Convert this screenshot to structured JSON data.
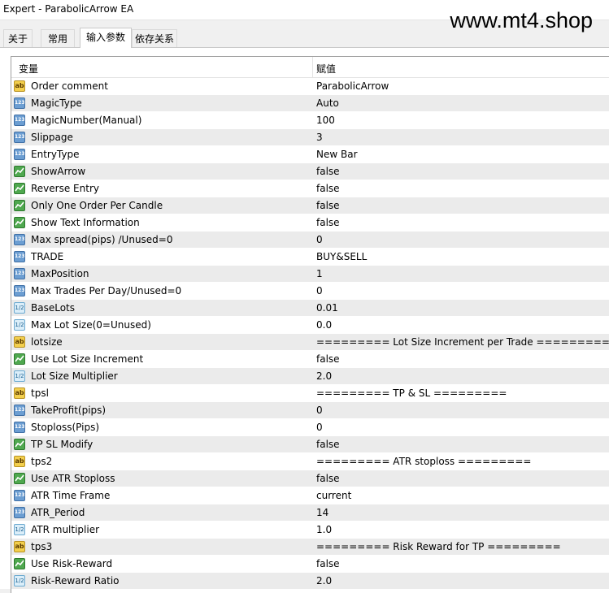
{
  "window": {
    "title": "Expert - ParabolicArrow EA"
  },
  "watermark": "www.mt4.shop",
  "tabs": [
    {
      "label": "关于"
    },
    {
      "label": "常用"
    },
    {
      "label": "输入参数"
    },
    {
      "label": "依存关系"
    }
  ],
  "grid": {
    "col_variable": "变量",
    "col_value": "赋值",
    "icon_labels": {
      "str": "ab",
      "num": "123",
      "dbl": "1/2"
    },
    "rows": [
      {
        "type": "str",
        "name": "Order comment",
        "value": "ParabolicArrow"
      },
      {
        "type": "num",
        "name": "MagicType",
        "value": "Auto"
      },
      {
        "type": "num",
        "name": "MagicNumber(Manual)",
        "value": "100"
      },
      {
        "type": "num",
        "name": "Slippage",
        "value": "3"
      },
      {
        "type": "num",
        "name": "EntryType",
        "value": "New Bar"
      },
      {
        "type": "bool",
        "name": "ShowArrow",
        "value": "false"
      },
      {
        "type": "bool",
        "name": "Reverse Entry",
        "value": "false"
      },
      {
        "type": "bool",
        "name": "Only One Order Per Candle",
        "value": "false"
      },
      {
        "type": "bool",
        "name": "Show Text Information",
        "value": "false"
      },
      {
        "type": "num",
        "name": "Max spread(pips) /Unused=0",
        "value": "0"
      },
      {
        "type": "num",
        "name": "TRADE",
        "value": "BUY&SELL"
      },
      {
        "type": "num",
        "name": "MaxPosition",
        "value": "1"
      },
      {
        "type": "num",
        "name": "Max Trades Per Day/Unused=0",
        "value": "0"
      },
      {
        "type": "dbl",
        "name": "BaseLots",
        "value": "0.01"
      },
      {
        "type": "dbl",
        "name": "Max Lot Size(0=Unused)",
        "value": "0.0"
      },
      {
        "type": "str",
        "name": "lotsize",
        "value": "========= Lot Size Increment per Trade ========="
      },
      {
        "type": "bool",
        "name": "Use Lot Size Increment",
        "value": "false"
      },
      {
        "type": "dbl",
        "name": "Lot Size Multiplier",
        "value": "2.0"
      },
      {
        "type": "str",
        "name": "tpsl",
        "value": "========= TP & SL ========="
      },
      {
        "type": "num",
        "name": "TakeProfit(pips)",
        "value": "0"
      },
      {
        "type": "num",
        "name": "Stoploss(Pips)",
        "value": "0"
      },
      {
        "type": "bool",
        "name": "TP SL Modify",
        "value": "false"
      },
      {
        "type": "str",
        "name": "tps2",
        "value": "========= ATR stoploss ========="
      },
      {
        "type": "bool",
        "name": "Use ATR Stoploss",
        "value": "false"
      },
      {
        "type": "num",
        "name": "ATR Time Frame",
        "value": "current"
      },
      {
        "type": "num",
        "name": "ATR_Period",
        "value": "14"
      },
      {
        "type": "dbl",
        "name": "ATR multiplier",
        "value": "1.0"
      },
      {
        "type": "str",
        "name": "tps3",
        "value": "========= Risk Reward for TP ========="
      },
      {
        "type": "bool",
        "name": "Use Risk-Reward",
        "value": "false"
      },
      {
        "type": "dbl",
        "name": "Risk-Reward Ratio",
        "value": "2.0"
      }
    ]
  }
}
